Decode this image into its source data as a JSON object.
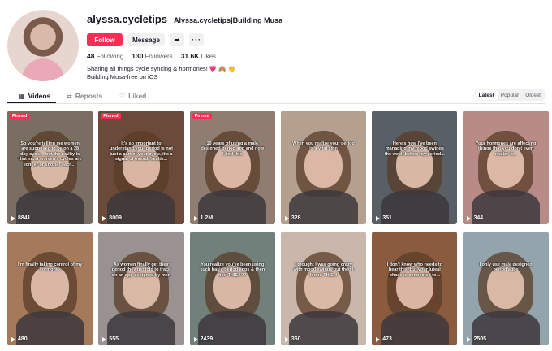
{
  "profile": {
    "username": "alyssa.cycletips",
    "nickname": "Alyssa.cycletips|Building Musa",
    "follow_label": "Follow",
    "message_label": "Message",
    "share_icon": "share-icon",
    "more_icon": "more-icon",
    "following_count": "48",
    "following_label": "Following",
    "followers_count": "130",
    "followers_label": "Followers",
    "likes_count": "31.6K",
    "likes_label": "Likes",
    "bio_line1": "Sharing all things cycle syncing & hormones!",
    "bio_emoji": "💗 🙈 👏",
    "bio_line2": "Building Musa-free on iOS"
  },
  "tabs": {
    "videos": "Videos",
    "reposts": "Reposts",
    "liked": "Liked"
  },
  "sort": {
    "latest": "Latest",
    "popular": "Popular",
    "oldest": "Oldest"
  },
  "videos": [
    {
      "views": "8841",
      "pinned": "Pinned",
      "caption": "So you're telling me women are supposed to be on a 28 day cycle... but the reality is that most women's cycles are longer or shorter each...",
      "bg": "#7a6e62"
    },
    {
      "views": "8009",
      "pinned": "Pinned",
      "caption": "It's so important to understand your period is not just a part of your cycle, it's a signal of overall health...",
      "bg": "#6b4a3a"
    },
    {
      "views": "1.2M",
      "pinned": "Pinned",
      "caption": "10 years of using a male designed period app and now I find this",
      "bg": "#8f7d72"
    },
    {
      "views": "328",
      "pinned": "",
      "caption": "When you realize your period is a vital sign",
      "bg": "#b5a08f"
    },
    {
      "views": "351",
      "pinned": "",
      "caption": "Here's how I've been managing my mood swings the week before my period...",
      "bg": "#586066"
    },
    {
      "views": "344",
      "pinned": "",
      "caption": "Your hormones are affecting things that you don't even realize it...",
      "bg": "#b88b86"
    },
    {
      "views": "480",
      "pinned": "",
      "caption": "I'm finally taking control of my hormones",
      "bg": "#a57a5a"
    },
    {
      "views": "555",
      "pinned": "",
      "caption": "As women finally get their period they get told to track on an app designed by men",
      "bg": "#9a9290"
    },
    {
      "views": "2439",
      "pinned": "",
      "caption": "You realize you've been using such basic period apps & then find THIS!!??",
      "bg": "#72807b"
    },
    {
      "views": "360",
      "pinned": "",
      "caption": "I thought I was going crazy with mood swings but then I found THIS..!",
      "bg": "#c9b7ac"
    },
    {
      "views": "473",
      "pinned": "",
      "caption": "I don't know who needs to hear this, but your luteal phase is connected to...",
      "bg": "#8b5b3f"
    },
    {
      "views": "2505",
      "pinned": "",
      "caption": "I only use male designed period apps",
      "bg": "#94a4ad"
    }
  ]
}
